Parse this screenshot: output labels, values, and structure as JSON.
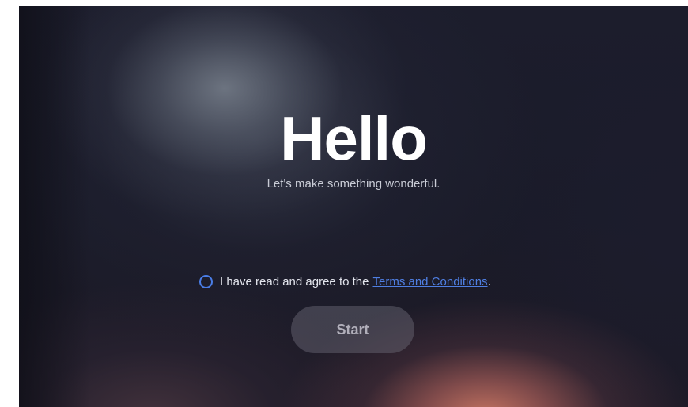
{
  "welcome": {
    "title": "Hello",
    "subtitle": "Let's make something wonderful."
  },
  "consent": {
    "text": "I have read and agree to the",
    "link_label": "Terms and Conditions",
    "trailing": ".",
    "checked": false,
    "accent_color": "#4a7ee8"
  },
  "actions": {
    "start_label": "Start",
    "start_enabled": false
  }
}
